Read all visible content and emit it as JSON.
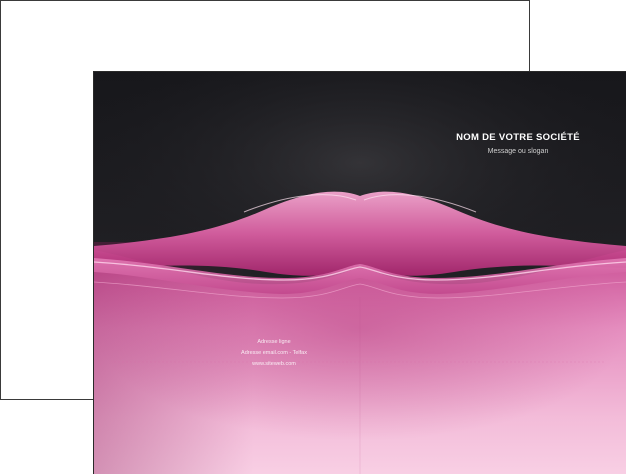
{
  "brochure": {
    "company_name": "NOM DE VOTRE SOCIÉTÉ",
    "slogan": "Message ou slogan",
    "contact": {
      "address": "Adresse ligne",
      "email_phone": "Adresse email.com - Telfax",
      "website": "www.siteweb.com"
    }
  },
  "colors": {
    "dark_background": "#1e1e22",
    "pink_light": "#f6c4de",
    "pink_mid": "#e384b8",
    "pink_deep": "#c23a86",
    "sheet_border": "#3a3a3a"
  }
}
